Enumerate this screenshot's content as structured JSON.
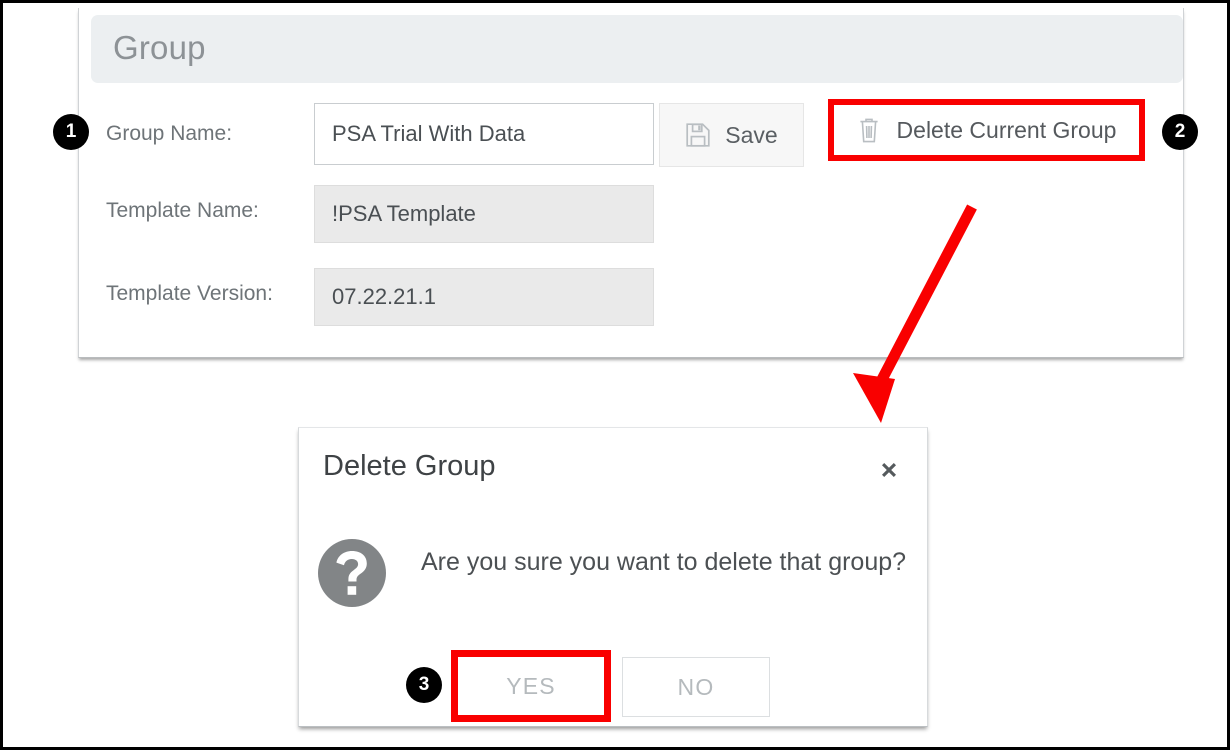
{
  "panel": {
    "header_title": "Group",
    "rows": [
      {
        "label": "Group Name:",
        "value": "PSA Trial With Data",
        "readonly": false
      },
      {
        "label": "Template Name:",
        "value": "!PSA Template",
        "readonly": true
      },
      {
        "label": "Template Version:",
        "value": "07.22.21.1",
        "readonly": true
      }
    ],
    "save_button": {
      "label": "Save",
      "icon": "floppy-disk-icon"
    },
    "delete_button": {
      "label": "Delete Current Group",
      "icon": "trash-can-icon"
    }
  },
  "callouts": [
    {
      "number": "1",
      "target": "group-name-field"
    },
    {
      "number": "2",
      "target": "delete-current-group-button"
    },
    {
      "number": "3",
      "target": "yes-button"
    }
  ],
  "dialog": {
    "title": "Delete Group",
    "close_icon": "close-x-icon",
    "message": "Are you sure you want to delete that group?",
    "message_icon": "question-mark-icon",
    "buttons": [
      {
        "label": "YES",
        "highlighted": true
      },
      {
        "label": "NO",
        "highlighted": false
      }
    ]
  },
  "colors": {
    "highlight_red": "#f90000",
    "header_bar": "#eceff1",
    "readonly_field": "#eaeaea",
    "label_text": "#6e7478",
    "badge_bg": "#000000",
    "question_icon": "#808080",
    "disabled_button_text": "#b5babd"
  }
}
